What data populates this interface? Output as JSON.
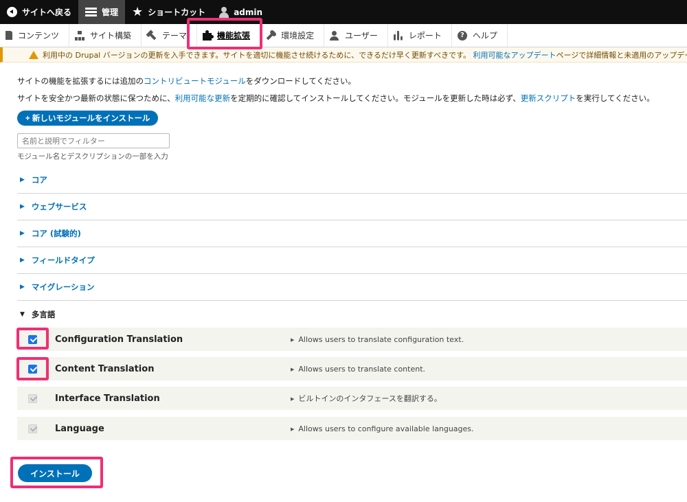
{
  "toolbar": {
    "back": "サイトへ戻る",
    "manage": "管理",
    "shortcuts": "ショートカット",
    "user": "admin"
  },
  "tray": {
    "content": "コンテンツ",
    "structure": "サイト構築",
    "appearance": "テーマ",
    "extend": "機能拡張",
    "config": "環境設定",
    "people": "ユーザー",
    "reports": "レポート",
    "help": "ヘルプ"
  },
  "warning": {
    "text": "利用中の Drupal バージョンの更新を入手できます。サイトを適切に機能させ続けるために、できるだけ早く更新すべきです。",
    "link": "利用可能なアップデート",
    "tail": "ページで詳細情報と未適用のアップデートを確認してください。"
  },
  "help": {
    "line1_pre": "サイトの機能を拡張するには追加の",
    "line1_link": "コントリビュートモジュール",
    "line1_post": "をダウンロードしてください。",
    "line2_pre": "サイトを安全かつ最新の状態に保つために、",
    "line2_link1": "利用可能な更新",
    "line2_mid": "を定期的に確認してインストールしてください。モジュールを更新した時は必ず、",
    "line2_link2": "更新スクリプト",
    "line2_post": "を実行してください。"
  },
  "install_new_label": "+ 新しいモジュールをインストール",
  "filter": {
    "placeholder": "名前と説明でフィルター",
    "description": "モジュール名とデスクリプションの一部を入力"
  },
  "groups": [
    {
      "label": "コア"
    },
    {
      "label": "ウェブサービス"
    },
    {
      "label": "コア (試験的)"
    },
    {
      "label": "フィールドタイプ"
    },
    {
      "label": "マイグレーション"
    },
    {
      "label": "多言語"
    }
  ],
  "modules": [
    {
      "name": "Configuration Translation",
      "description": "Allows users to translate configuration text.",
      "state": "checked"
    },
    {
      "name": "Content Translation",
      "description": "Allows users to translate content.",
      "state": "checked"
    },
    {
      "name": "Interface Translation",
      "description": "ビルトインのインタフェースを翻訳する。",
      "state": "disabled"
    },
    {
      "name": "Language",
      "description": "Allows users to configure available languages.",
      "state": "disabled"
    }
  ],
  "install_label": "インストール",
  "colors": {
    "accent": "#0071b8",
    "highlight": "#ee2f74",
    "warning": "#e29700"
  }
}
